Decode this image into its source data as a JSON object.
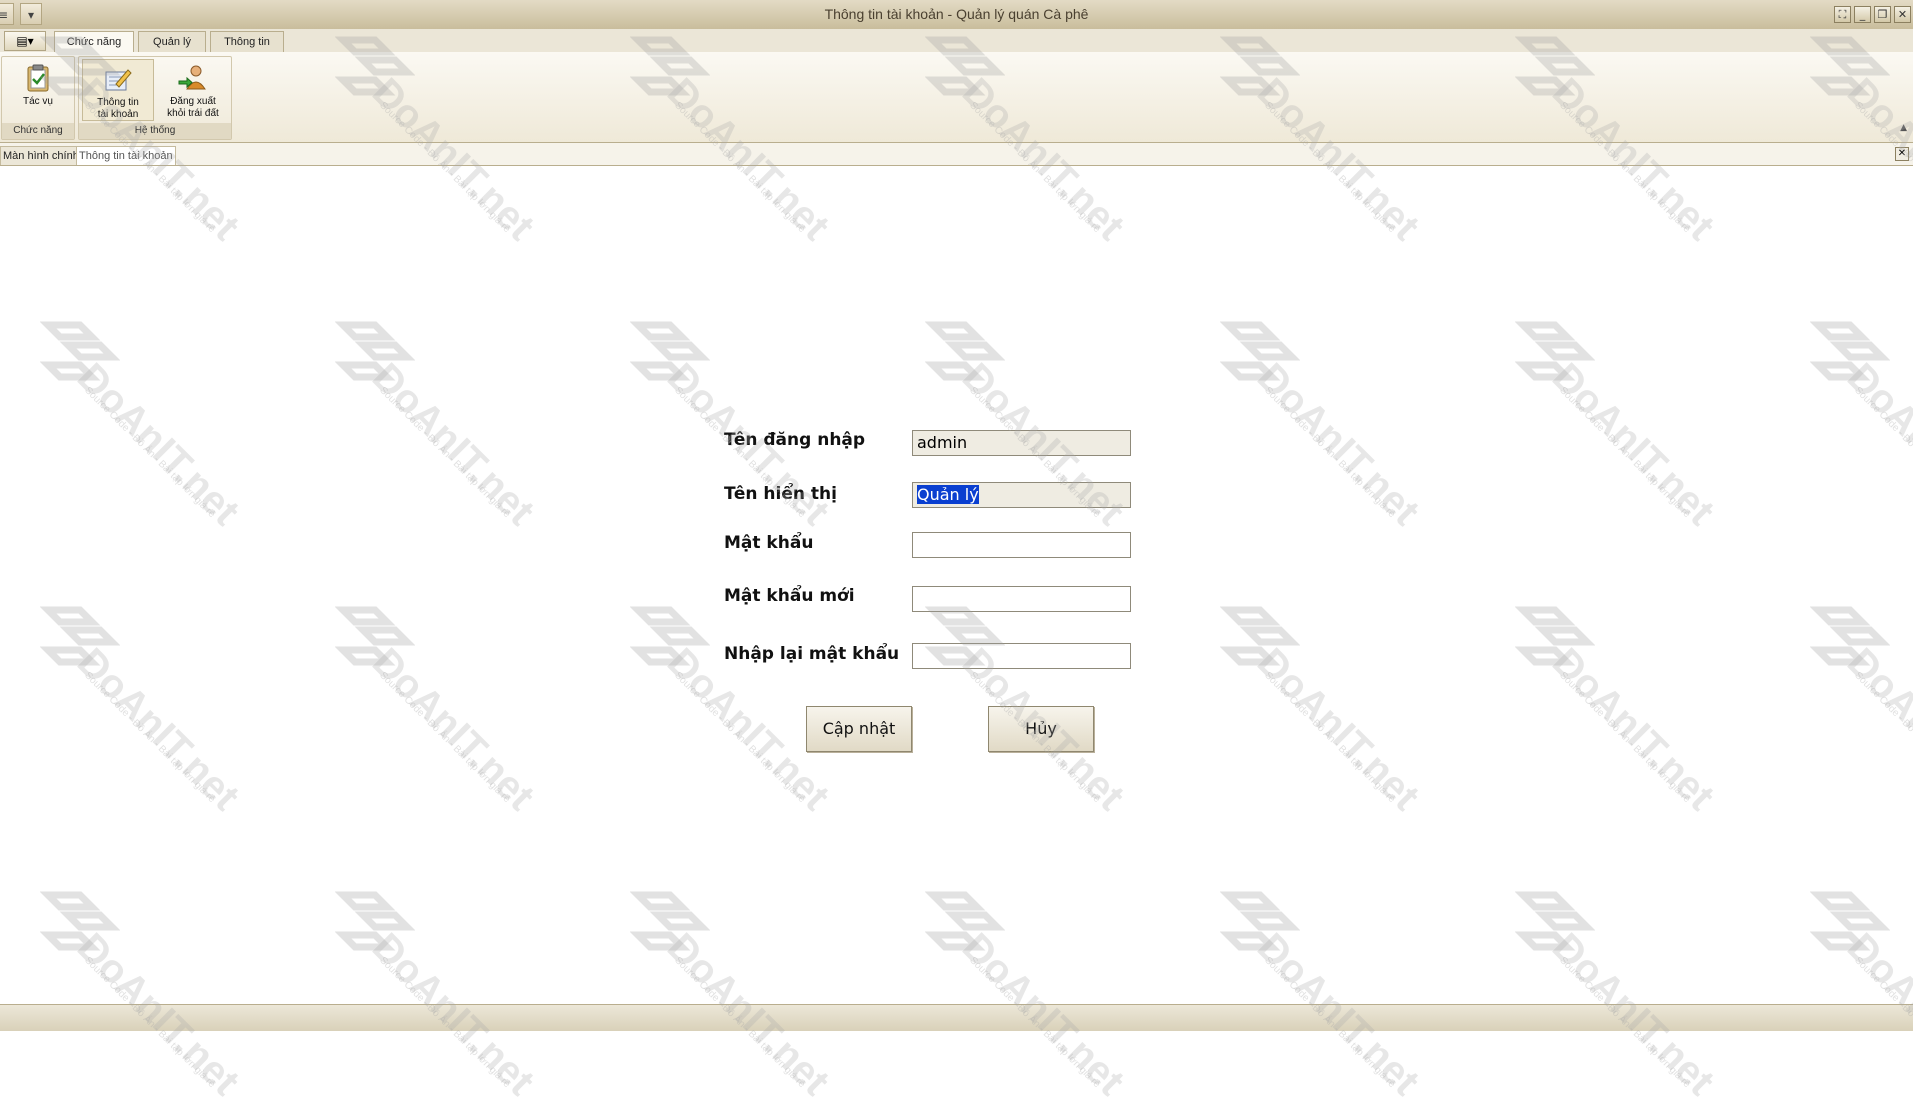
{
  "window": {
    "title_main": "Thông tin tài khoản",
    "title_separator": " - ",
    "title_app": "Quản lý quán Cà phê"
  },
  "ribbon": {
    "tabs": [
      {
        "label": "Chức năng",
        "active": true
      },
      {
        "label": "Quản lý",
        "active": false
      },
      {
        "label": "Thông tin",
        "active": false
      }
    ],
    "groups": {
      "chuc_nang": {
        "label": "Chức năng",
        "button_task_label": "Tác vụ"
      },
      "he_thong": {
        "label": "Hệ thống",
        "button_account_line1": "Thông tin",
        "button_account_line2": "tài khoản",
        "button_logout_line1": "Đăng xuất",
        "button_logout_line2": "khỏi trái đất"
      }
    }
  },
  "document_tabs": [
    {
      "label": "Màn hình chính",
      "active": false
    },
    {
      "label": "Thông tin tài khoản",
      "active": true
    }
  ],
  "form": {
    "username_label": "Tên đăng nhập",
    "username_value": "admin",
    "display_name_label": "Tên hiển thị",
    "display_name_value": "Quản lý",
    "password_label": "Mật khẩu",
    "password_value": "",
    "new_password_label": "Mật khẩu mới",
    "new_password_value": "",
    "confirm_password_label": "Nhập lại mật khẩu",
    "confirm_password_value": "",
    "update_button": "Cập nhật",
    "cancel_button": "Hủy"
  },
  "watermark": {
    "brand": "DoAnIT.net",
    "tagline": "Source Code - Đồ Án - Bài tập lớn giá rẻ"
  }
}
